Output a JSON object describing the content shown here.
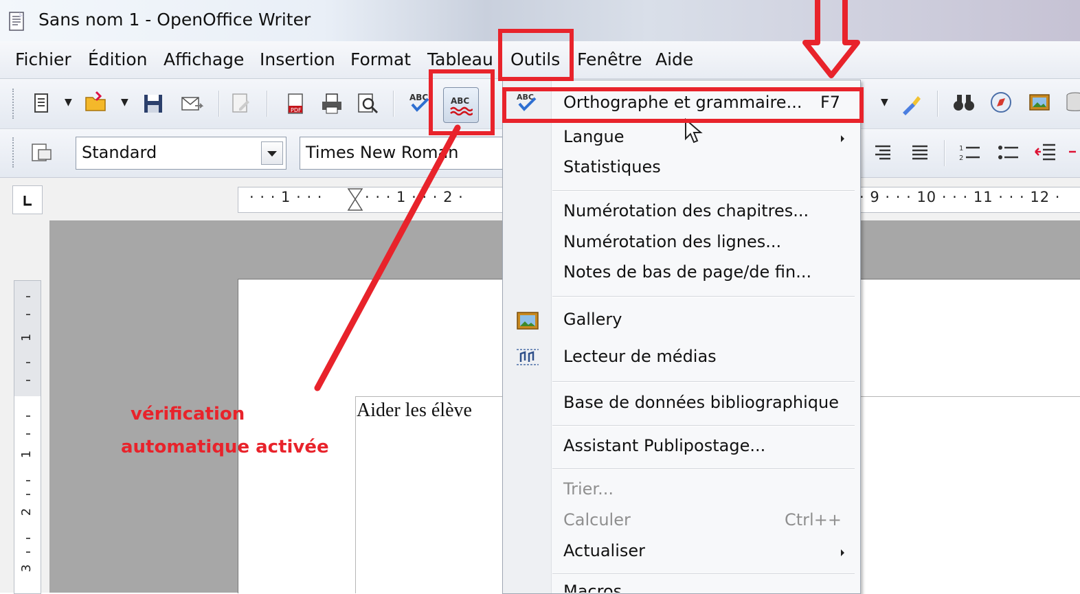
{
  "window": {
    "title": "Sans nom 1 - OpenOffice Writer"
  },
  "menubar": {
    "items": [
      {
        "label": "Fichier"
      },
      {
        "label": "Édition"
      },
      {
        "label": "Affichage"
      },
      {
        "label": "Insertion"
      },
      {
        "label": "Format"
      },
      {
        "label": "Tableau"
      },
      {
        "label": "Outils"
      },
      {
        "label": "Fenêtre"
      },
      {
        "label": "Aide"
      }
    ]
  },
  "toolbar": {
    "paragraph_style": "Standard",
    "font_name": "Times New Roman",
    "autospell_icon": "abc-autospell-icon",
    "spellcheck_icon": "abc-spellcheck-icon"
  },
  "ruler": {
    "labels_left": "· · · 1 · · ·",
    "labels_mid": "· · · 1 · · · 2 ·",
    "labels_right": "· 9 · · · 10 · · · 11 · · · 12 ·"
  },
  "vertical_ruler": {
    "labels": [
      "1",
      "1",
      "2",
      "3"
    ]
  },
  "document": {
    "text": "Aider les élève"
  },
  "tools_menu": {
    "items": [
      {
        "label": "Orthographe et grammaire...",
        "shortcut": "F7",
        "icon": "spellcheck-icon"
      },
      {
        "label": "Langue",
        "submenu": true
      },
      {
        "label": "Statistiques"
      },
      {
        "label": "Numérotation des chapitres..."
      },
      {
        "label": "Numérotation des lignes..."
      },
      {
        "label": "Notes de bas de page/de fin..."
      },
      {
        "label": "Gallery",
        "icon": "gallery-icon"
      },
      {
        "label": "Lecteur de médias",
        "icon": "media-player-icon"
      },
      {
        "label": "Base de données bibliographique"
      },
      {
        "label": "Assistant Publipostage..."
      },
      {
        "label": "Trier...",
        "disabled": true
      },
      {
        "label": "Calculer",
        "shortcut": "Ctrl++",
        "disabled": true
      },
      {
        "label": "Actualiser",
        "submenu": true
      },
      {
        "label": "Macros"
      }
    ]
  },
  "annotation": {
    "line1": "vérification",
    "line2": "automatique  activée",
    "color": "#e8232b"
  }
}
